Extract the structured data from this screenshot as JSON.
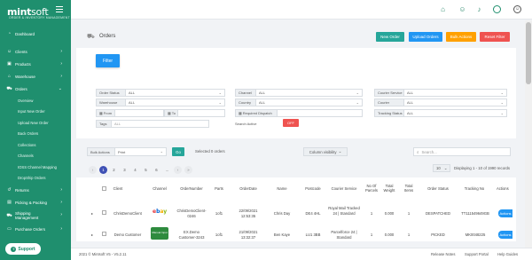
{
  "brand": {
    "logo_main": "mint",
    "logo_sub": "soft",
    "tagline": "ORDER & INVENTORY MANAGEMENT"
  },
  "sidebar": {
    "items": [
      {
        "label": "Dashboard",
        "icon": "dashboard-icon"
      },
      {
        "label": "Clients",
        "icon": "users-icon"
      },
      {
        "label": "Products",
        "icon": "box-icon"
      },
      {
        "label": "Warehouse",
        "icon": "warehouse-icon"
      },
      {
        "label": "Orders",
        "icon": "cart-icon"
      }
    ],
    "sub_items": [
      "Overview",
      "Input New Order",
      "Upload New Order",
      "Back Orders",
      "Collections",
      "Channels",
      "IOSS Channel Mapping",
      "DropShip Orders"
    ],
    "items_after": [
      {
        "label": "Returns",
        "icon": "return-icon"
      },
      {
        "label": "Picking & Packing",
        "icon": "package-icon"
      },
      {
        "label": "Shipping Management",
        "icon": "truck-icon"
      },
      {
        "label": "Purchase Orders",
        "icon": "document-icon"
      }
    ],
    "support_label": "Support"
  },
  "header": {
    "title": "Orders"
  },
  "header_buttons": [
    {
      "label": "New Order",
      "color": "#26a69a"
    },
    {
      "label": "Upload Orders",
      "color": "#2196f3"
    },
    {
      "label": "Bulk Actions",
      "color": "#ffa000"
    },
    {
      "label": "Reset Filter",
      "color": "#ef5350"
    }
  ],
  "filter": {
    "button_label": "Filter",
    "order_status": {
      "label": "Order Status",
      "value": "ALL"
    },
    "warehouse": {
      "label": "Warehouse",
      "value": "ALL"
    },
    "from": {
      "label": "From",
      "value": ""
    },
    "to": {
      "label": "To",
      "value": ""
    },
    "tags": {
      "label": "Tags",
      "placeholder": "ALL"
    },
    "channel": {
      "label": "Channel",
      "value": "ALL"
    },
    "country": {
      "label": "Country",
      "value": "ALL"
    },
    "required_dispatch": {
      "label": "Required Dispatch",
      "value": ""
    },
    "search_active": {
      "label": "Search Active",
      "button": "OFF"
    },
    "courier_service": {
      "label": "Courier Service",
      "value": "ALL"
    },
    "courier": {
      "label": "Courier",
      "value": "ALL"
    },
    "tracking_status": {
      "label": "Tracking Status",
      "value": "ALL"
    }
  },
  "action_bar": {
    "bulk_actions_label": "Bulk Actions",
    "bulk_value": "Print",
    "go_label": "Go",
    "selected_text": "Selected 0 orders",
    "column_visibility": "Column visibility",
    "search_placeholder": "Search..."
  },
  "pagination": {
    "pages": [
      "1",
      "2",
      "3",
      "4",
      "5",
      "6",
      "...",
      "20"
    ],
    "current": "1",
    "per_page": "10",
    "summary": "Displaying 1 - 10 of 1990 records"
  },
  "table": {
    "columns": [
      "Client",
      "Channel",
      "OrderNumber",
      "Parts",
      "OrderDate",
      "Name",
      "Postcode",
      "Courier Service",
      "No Of Parcels",
      "Total Weight",
      "Total Items",
      "Order Status",
      "Tracking No",
      "Actions"
    ],
    "rows": [
      {
        "client": "ChrisDemoClient",
        "channel": "ebay",
        "order_number": "ChrisDemoClient-0246",
        "parts": "1of1",
        "order_date": "22/09/2021 12:53:35",
        "name": "Chris Day",
        "postcode": "DE4 4HL",
        "courier_service": "Royal Mail Tracked 24 | Standard",
        "parcels": "1",
        "weight": "0.000",
        "items": "1",
        "status": "DESPATCHED",
        "tracking": "TT111549649GB",
        "action": "Actions"
      },
      {
        "client": "Demo Customer",
        "channel": "Manual Input",
        "order_number": "EX.Demo Customer-3243",
        "parts": "1of1",
        "order_date": "21/09/2021 13:32:37",
        "name": "Ben Kaye",
        "postcode": "LU1 3BB",
        "courier_service": "Parcelforce 24 | Standard",
        "parcels": "1",
        "weight": "0.000",
        "items": "1",
        "status": "PICKED",
        "tracking": "MK0048225",
        "action": "Actions"
      }
    ]
  },
  "footer": {
    "copyright": "2021 © Mintsoft V5 - V5.2.11",
    "links": [
      "Release Notes",
      "Support Portal",
      "Help Guides"
    ]
  }
}
